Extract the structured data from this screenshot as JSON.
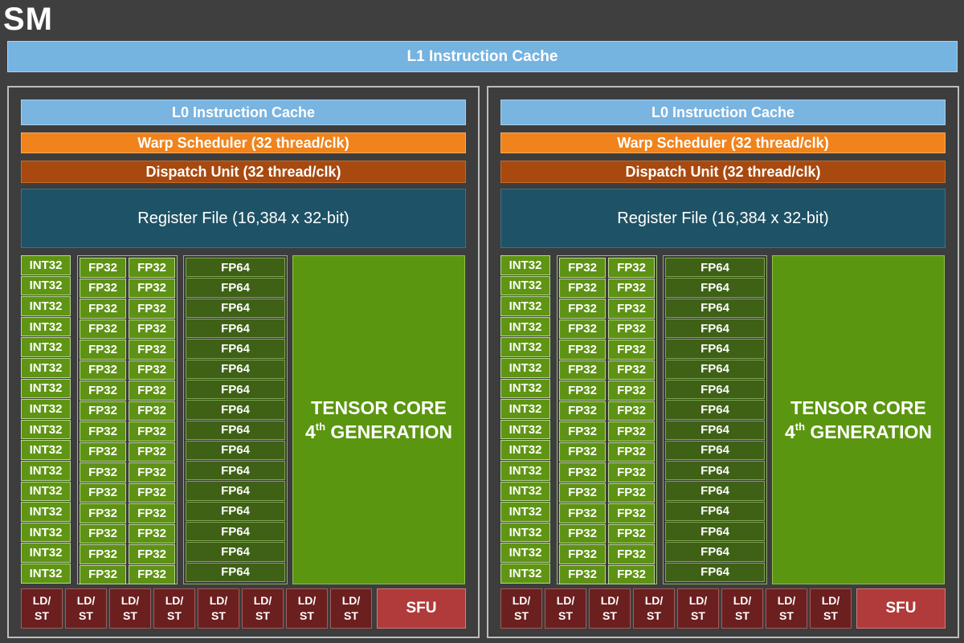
{
  "title": "SM",
  "l1_cache": "L1 Instruction Cache",
  "partitions": [
    {
      "l0_cache": "L0 Instruction Cache",
      "warp_scheduler": "Warp Scheduler (32 thread/clk)",
      "dispatch_unit": "Dispatch Unit (32 thread/clk)",
      "register_file": "Register File (16,384 x 32-bit)",
      "int32_label": "INT32",
      "int32_count": 16,
      "fp32_label": "FP32",
      "fp32_rows": 16,
      "fp64_label": "FP64",
      "fp64_count": 16,
      "tensor_line1": "TENSOR CORE",
      "tensor_num": "4",
      "tensor_sup": "th",
      "tensor_line2": " GENERATION",
      "ldst_top": "LD/",
      "ldst_bottom": "ST",
      "ldst_count": 8,
      "sfu": "SFU"
    },
    {
      "l0_cache": "L0 Instruction Cache",
      "warp_scheduler": "Warp Scheduler (32 thread/clk)",
      "dispatch_unit": "Dispatch Unit (32 thread/clk)",
      "register_file": "Register File (16,384 x 32-bit)",
      "int32_label": "INT32",
      "int32_count": 16,
      "fp32_label": "FP32",
      "fp32_rows": 16,
      "fp64_label": "FP64",
      "fp64_count": 16,
      "tensor_line1": "TENSOR CORE",
      "tensor_num": "4",
      "tensor_sup": "th",
      "tensor_line2": " GENERATION",
      "ldst_top": "LD/",
      "ldst_bottom": "ST",
      "ldst_count": 8,
      "sfu": "SFU"
    }
  ]
}
